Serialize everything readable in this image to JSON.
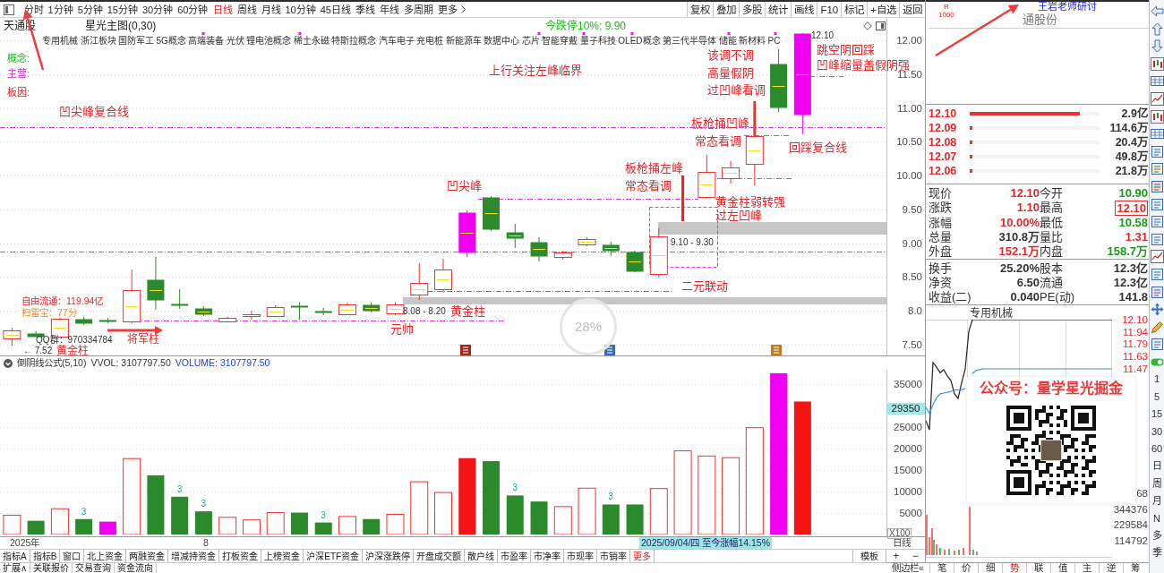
{
  "toolbar": {
    "periods": [
      {
        "label": "分时",
        "selected": false
      },
      {
        "label": "1分钟",
        "selected": false
      },
      {
        "label": "5分钟",
        "selected": false
      },
      {
        "label": "15分钟",
        "selected": false
      },
      {
        "label": "30分钟",
        "selected": false
      },
      {
        "label": "60分钟",
        "selected": false
      },
      {
        "label": "日线",
        "selected": true
      },
      {
        "label": "周线",
        "selected": false
      },
      {
        "label": "月线",
        "selected": false
      },
      {
        "label": "10分钟",
        "selected": false
      },
      {
        "label": "45日线",
        "selected": false
      },
      {
        "label": "季线",
        "selected": false
      },
      {
        "label": "年线",
        "selected": false
      },
      {
        "label": "多周期",
        "selected": false
      }
    ],
    "more": "更多",
    "actions": [
      "复权",
      "叠加",
      "多股",
      "统计",
      "画线",
      "F10",
      "标记",
      "+自选",
      "返回"
    ]
  },
  "main_chart": {
    "stock_name": "天通股",
    "indicator": "星光主图(0,30)",
    "limit_down": "今跌停10%: 9.90",
    "concepts": [
      "专用机械",
      "浙江板块",
      "国防军工",
      "5G概念",
      "高端装备",
      "光伏",
      "锂电池概念",
      "稀土永磁",
      "特斯拉概念",
      "汽车电子",
      "充电桩",
      "新能源车",
      "数据中心",
      "芯片",
      "智能穿戴",
      "量子科技",
      "OLED概念",
      "第三代半导体",
      "储能",
      "新材料",
      "PC"
    ],
    "labels": [
      {
        "text": "概念:",
        "kind": "concept"
      },
      {
        "text": "主营:",
        "kind": "business"
      },
      {
        "text": "板因:",
        "kind": "reason"
      }
    ],
    "price_ticks": [
      "12.00",
      "11.50",
      "11.00",
      "10.50",
      "10.00",
      "9.50",
      "9.00",
      "8.50",
      "8.0",
      "7.50"
    ],
    "annotations": [
      {
        "text": "12.10",
        "kind": "plain"
      },
      {
        "text": "跳空阴回踩",
        "kind": "note"
      },
      {
        "text": "该调不调",
        "kind": "note"
      },
      {
        "text": "凹峰缩量盖假阴强",
        "kind": "note"
      },
      {
        "text": "上行关注左峰临界",
        "kind": "note"
      },
      {
        "text": "高量假阴",
        "kind": "note"
      },
      {
        "text": "过凹峰看调",
        "kind": "note"
      },
      {
        "text": "凹尖峰复合线",
        "kind": "note"
      },
      {
        "text": "板枪捅凹峰",
        "kind": "note"
      },
      {
        "text": "常态看调",
        "kind": "note"
      },
      {
        "text": "回踩复合线",
        "kind": "note"
      },
      {
        "text": "板枪捅左峰",
        "kind": "note"
      },
      {
        "text": "凹尖峰",
        "kind": "note"
      },
      {
        "text": "常态看调",
        "kind": "note"
      },
      {
        "text": "黄金柱弱转强",
        "kind": "note"
      },
      {
        "text": "过左凹峰",
        "kind": "note"
      },
      {
        "text": "9.10 - 9.30",
        "kind": "range"
      },
      {
        "text": "二元联动",
        "kind": "note"
      },
      {
        "text": "自由流通：119.94亿",
        "kind": "info"
      },
      {
        "text": "扫雷宝：77分",
        "kind": "score"
      },
      {
        "text": "8.08 - 8.20",
        "kind": "range"
      },
      {
        "text": "黄金柱",
        "kind": "note"
      },
      {
        "text": "元帅",
        "kind": "note"
      },
      {
        "text": "QQ群：970334784",
        "kind": "plain"
      },
      {
        "text": "将军柱",
        "kind": "label"
      },
      {
        "text": "← 7.52",
        "kind": "plain"
      },
      {
        "text": "黄金柱",
        "kind": "label"
      }
    ]
  },
  "volume_panel": {
    "title": "倒阴线公式(5,10)",
    "vvol": "VVOL: 3107797.50",
    "volume": "VOLUME: 3107797.50",
    "cursor_value": "29350",
    "unit": "X100",
    "count_labels": [
      "3",
      "3",
      "3",
      "3",
      "3",
      "3"
    ],
    "chart_data": {
      "type": "bar",
      "values": [
        4500,
        3200,
        6000,
        3600,
        3000,
        17700,
        13800,
        8800,
        5400,
        4000,
        3400,
        5100,
        5100,
        2800,
        4200,
        3600,
        4700,
        12300,
        9800,
        17800,
        17100,
        9100,
        7700,
        6500,
        10800,
        7000,
        7000,
        10700,
        19500,
        18300,
        17900,
        24900,
        37600,
        31000,
        null,
        null,
        null
      ],
      "ylim": [
        0,
        38400
      ],
      "yticks": [
        5000,
        10000,
        15000,
        20000,
        25000,
        35000
      ],
      "grid": true
    }
  },
  "date_axis": {
    "labels": [
      "2025年",
      "8"
    ],
    "cursor_tag": "2025/09/04/四 至今涨幅14.15%"
  },
  "axis_column": {
    "period": "日线",
    "zoom_buttons": [
      "+",
      "−"
    ]
  },
  "bottom_tabs": {
    "tabs": [
      "指标A",
      "指标B",
      "窗口",
      "北上资金",
      "两融资金",
      "增减持资金",
      "打板资金",
      "上榜资金",
      "沪深ETF资金",
      "沪深涨跌停",
      "开盘成交额",
      "散户线",
      "市盈率",
      "市净率",
      "市现率",
      "市销率"
    ],
    "more": "更多",
    "template": "模板"
  },
  "bottom_links": [
    "扩展∧",
    "关联报价",
    "交易查询",
    "资金流向"
  ],
  "quote_panel": {
    "badge": "R",
    "badge_sub": "1000",
    "stock_name": "通股份",
    "tag": "王岩老师研讨",
    "order_book": [
      {
        "price": "12.10",
        "volume": "2.9亿",
        "level": 0.85
      },
      {
        "price": "12.09",
        "volume": "114.6万",
        "level": 0.02
      },
      {
        "price": "12.08",
        "volume": "20.4万",
        "level": 0.02
      },
      {
        "price": "12.07",
        "volume": "49.8万",
        "level": 0.02
      },
      {
        "price": "12.06",
        "volume": "21.8万",
        "level": 0.02
      }
    ],
    "stats": [
      [
        {
          "label": "现价",
          "value": "12.10",
          "color": "#e8262a",
          "boxed": false
        },
        {
          "label": "今开",
          "value": "10.90",
          "color": "#1a9a1a",
          "boxed": false
        },
        {
          "label": "涨跌",
          "value": "1.10",
          "color": "#e8262a",
          "boxed": false
        },
        {
          "label": "最高",
          "value": "12.10",
          "color": "#e8262a",
          "boxed": true
        },
        {
          "label": "涨幅",
          "value": "10.00%",
          "color": "#e8262a",
          "boxed": false
        },
        {
          "label": "最低",
          "value": "10.58",
          "color": "#1a9a1a",
          "boxed": false
        },
        {
          "label": "总量",
          "value": "310.8万",
          "color": "#333333",
          "boxed": false
        },
        {
          "label": "量比",
          "value": "1.31",
          "color": "#e8262a",
          "boxed": false
        },
        {
          "label": "外盘",
          "value": "152.1万",
          "color": "#e8262a",
          "boxed": false
        },
        {
          "label": "内盘",
          "value": "158.7万",
          "color": "#1a9a1a",
          "boxed": false
        }
      ],
      [
        {
          "label": "换手",
          "value": "25.20%",
          "color": "#333333",
          "boxed": false
        },
        {
          "label": "股本",
          "value": "12.3亿",
          "color": "#333333",
          "boxed": false
        },
        {
          "label": "净资",
          "value": "6.50",
          "color": "#333333",
          "boxed": false
        },
        {
          "label": "流通",
          "value": "12.3亿",
          "color": "#333333",
          "boxed": false
        },
        {
          "label": "收益(二)",
          "value": "0.040",
          "color": "#333333",
          "boxed": false
        },
        {
          "label": "PE(动)",
          "value": "141.8",
          "color": "#333333",
          "boxed": false
        }
      ]
    ],
    "intraday": {
      "sector": "专用机械",
      "chart_data": {
        "type": "line",
        "ylim": [
          9.9,
          12.1
        ],
        "yticks": [
          {
            "value": 12.1,
            "label": "12.10"
          },
          {
            "value": 11.94,
            "label": "11.94"
          },
          {
            "value": 11.79,
            "label": "11.79"
          },
          {
            "value": 11.63,
            "label": "11.63"
          },
          {
            "value": 11.47,
            "label": "11.47"
          }
        ],
        "grid": true,
        "series": [
          {
            "color": "#222222",
            "values": [
              10.81,
              10.69,
              11.55,
              11.49,
              11.42,
              11.46,
              11.38,
              11.32,
              11.15,
              11.09,
              11.29,
              11.47,
              11.95,
              12.1,
              12.1,
              12.1,
              12.1,
              12.1,
              12.1,
              12.1,
              12.1,
              12.1,
              12.1,
              12.1,
              12.1,
              12.1,
              12.1,
              12.1,
              12.1,
              12.1,
              12.1,
              12.1,
              12.1,
              12.1,
              12.1,
              12.1,
              12.1,
              12.1,
              12.1,
              12.1,
              12.1,
              12.1,
              12.1,
              12.1,
              12.1,
              12.1,
              12.1,
              12.1,
              12.1,
              12.1,
              12.1,
              12.1,
              12.1
            ]
          },
          {
            "color": "#3d8fd8",
            "values": [
              10.98,
              10.9,
              11.01,
              11.1,
              11.15,
              11.16,
              11.17,
              11.18,
              11.2,
              11.2,
              11.2,
              11.22,
              null,
              11.41,
              11.45,
              11.46,
              11.47,
              11.47,
              11.47,
              11.47,
              11.47,
              11.47,
              11.47,
              11.47,
              11.47,
              11.47,
              11.47,
              11.47,
              11.47,
              11.47,
              11.47,
              11.47,
              11.47,
              11.47,
              11.47,
              11.47,
              11.47,
              11.47,
              11.47,
              11.47,
              11.47,
              11.47,
              11.47,
              11.47,
              11.47,
              11.47,
              11.47,
              11.47,
              11.47,
              11.47,
              11.47,
              11.47,
              11.47
            ]
          }
        ]
      },
      "volume_ticks": [
        "68",
        "344376",
        "229584",
        "114792"
      ]
    },
    "tabs": {
      "label": "侧边栏«",
      "items": [
        {
          "label": "笔",
          "selected": false
        },
        {
          "label": "价",
          "selected": false
        },
        {
          "label": "细",
          "selected": false
        },
        {
          "label": "势",
          "selected": true
        },
        {
          "label": "联",
          "selected": false
        },
        {
          "label": "值",
          "selected": false
        },
        {
          "label": "主",
          "selected": false
        },
        {
          "label": "逆",
          "selected": false
        },
        {
          "label": "筹",
          "selected": false
        }
      ]
    }
  },
  "promo": {
    "title": "公众号：量学星光掘金"
  },
  "progress_ring": {
    "text": "28%"
  },
  "side_toolbar": {
    "periods": [
      "1",
      "5",
      "15",
      "30",
      "60"
    ],
    "cycles": [
      "日",
      "周",
      "月",
      "N",
      "多",
      "季"
    ]
  }
}
